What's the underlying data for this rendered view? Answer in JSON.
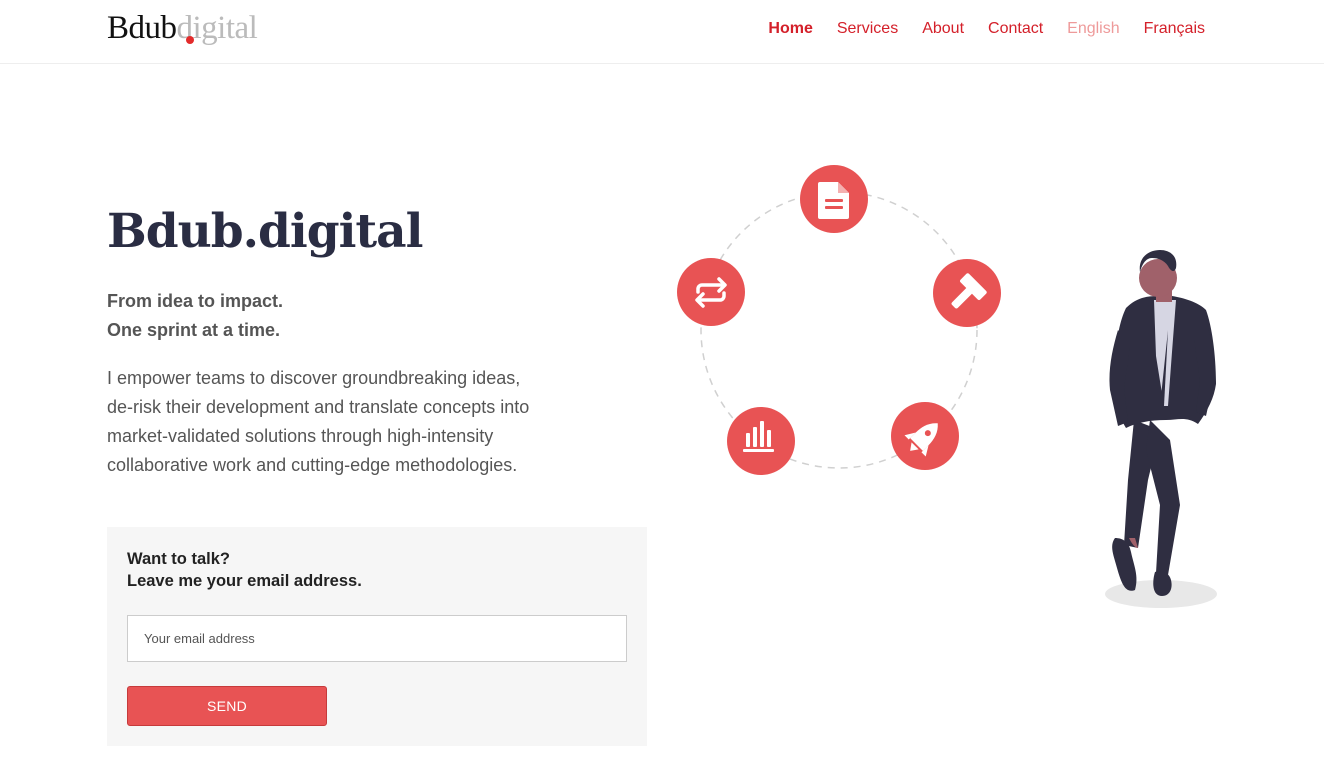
{
  "header": {
    "logo_main": "Bdub",
    "logo_suffix": "digital",
    "nav": [
      {
        "label": "Home"
      },
      {
        "label": "Services"
      },
      {
        "label": "About"
      },
      {
        "label": "Contact"
      },
      {
        "label": "English"
      },
      {
        "label": "Français"
      }
    ]
  },
  "hero": {
    "title": "Bdub.digital",
    "tagline_line1": "From idea to impact.",
    "tagline_line2": "One sprint at a time.",
    "intro": "I empower teams to discover groundbreaking ideas, de-risk their development and translate concepts into market-validated solutions through high-intensity collaborative work and cutting-edge methodologies."
  },
  "contact": {
    "heading_line1": "Want to talk?",
    "heading_line2": "Leave me your email address.",
    "email_value": "",
    "email_placeholder": "Your email address",
    "send_label": "SEND"
  },
  "illustration": {
    "accent_color": "#e85354",
    "icons": [
      "document-icon",
      "hammer-icon",
      "rocket-icon",
      "bar-chart-icon",
      "repeat-icon"
    ]
  }
}
